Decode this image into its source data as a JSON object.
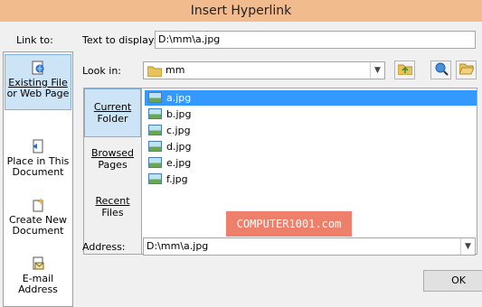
{
  "window": {
    "title": "Insert Hyperlink"
  },
  "link_to": {
    "label": "Link to:",
    "items": [
      {
        "line1": "Existing File",
        "line2": "or Web Page",
        "icon": "web-page-icon"
      },
      {
        "line1": "Place in This",
        "line2": "Document",
        "icon": "document-place-icon"
      },
      {
        "line1": "Create New",
        "line2": "Document",
        "icon": "new-document-icon"
      },
      {
        "line1": "E-mail",
        "line2": "Address",
        "icon": "email-icon"
      }
    ]
  },
  "text_to_display": {
    "label": "Text to display:",
    "value": "D:\\mm\\a.jpg"
  },
  "look_in": {
    "label": "Look in:",
    "value": "mm"
  },
  "browse_tabs": [
    {
      "line1": "Current",
      "line2": "Folder"
    },
    {
      "line1": "Browsed",
      "line2": "Pages"
    },
    {
      "line1": "Recent",
      "line2": "Files"
    }
  ],
  "files": [
    "a.jpg",
    "b.jpg",
    "c.jpg",
    "d.jpg",
    "e.jpg",
    "f.jpg"
  ],
  "watermark": "COMPUTER1001.com",
  "address": {
    "label": "Address:",
    "value": "D:\\mm\\a.jpg"
  },
  "buttons": {
    "ok": "OK"
  }
}
